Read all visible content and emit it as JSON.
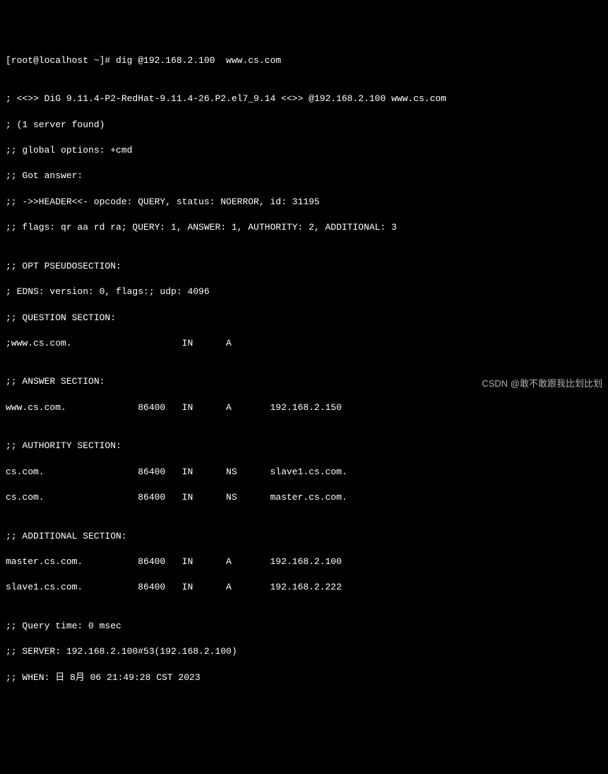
{
  "prompt": "[root@localhost ~]# dig @192.168.2.100  www.cs.com",
  "blank1": "",
  "version_line": "; <<>> DiG 9.11.4-P2-RedHat-9.11.4-26.P2.el7_9.14 <<>> @192.168.2.100 www.cs.com",
  "server_found": "; (1 server found)",
  "global_opts": ";; global options: +cmd",
  "got_answer": ";; Got answer:",
  "header_line": ";; ->>HEADER<<- opcode: QUERY, status: NOERROR, id: 31195",
  "flags_line": ";; flags: qr aa rd ra; QUERY: 1, ANSWER: 1, AUTHORITY: 2, ADDITIONAL: 3",
  "blank2": "",
  "opt_header": ";; OPT PSEUDOSECTION:",
  "edns_line": "; EDNS: version: 0, flags:; udp: 4096",
  "question_header": ";; QUESTION SECTION:",
  "question_row": ";www.cs.com.                    IN      A",
  "blank3": "",
  "answer_header": ";; ANSWER SECTION:",
  "answer_row": "www.cs.com.             86400   IN      A       192.168.2.150",
  "blank4": "",
  "authority_header": ";; AUTHORITY SECTION:",
  "authority_row1": "cs.com.                 86400   IN      NS      slave1.cs.com.",
  "authority_row2": "cs.com.                 86400   IN      NS      master.cs.com.",
  "blank5": "",
  "additional_header": ";; ADDITIONAL SECTION:",
  "additional_row1": "master.cs.com.          86400   IN      A       192.168.2.100",
  "additional_row2": "slave1.cs.com.          86400   IN      A       192.168.2.222",
  "blank6": "",
  "query_time": ";; Query time: 0 msec",
  "server_line": ";; SERVER: 192.168.2.100#53(192.168.2.100)",
  "when_line": ";; WHEN: 日 8月 06 21:49:28 CST 2023",
  "watermark": "CSDN @敢不敢跟我比划比划"
}
